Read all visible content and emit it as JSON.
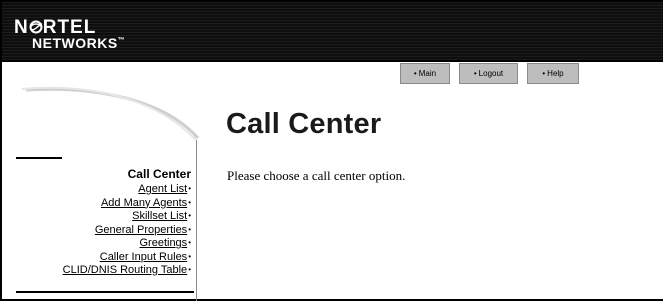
{
  "brand": {
    "logo_line1": "N",
    "logo_line1_rest": "RTEL",
    "logo_line2": "NETWORKS",
    "trademark": "™",
    "logo_name": "nortel-networks-logo"
  },
  "nav": {
    "main": "Main",
    "logout": "Logout",
    "help": "Help",
    "bullet": "•"
  },
  "page": {
    "title": "Call Center",
    "instruction": "Please choose a call center option."
  },
  "sidebar": {
    "heading": "Call Center",
    "bullet": "•",
    "items": [
      {
        "label": "Agent List"
      },
      {
        "label": "Add Many Agents"
      },
      {
        "label": "Skillset List"
      },
      {
        "label": "General Properties"
      },
      {
        "label": "Greetings"
      },
      {
        "label": "Caller Input Rules"
      },
      {
        "label": "CLID/DNIS Routing Table"
      }
    ]
  },
  "colors": {
    "header_bg": "#111111",
    "nav_button_bg": "#bdbdbd",
    "text": "#000000"
  }
}
